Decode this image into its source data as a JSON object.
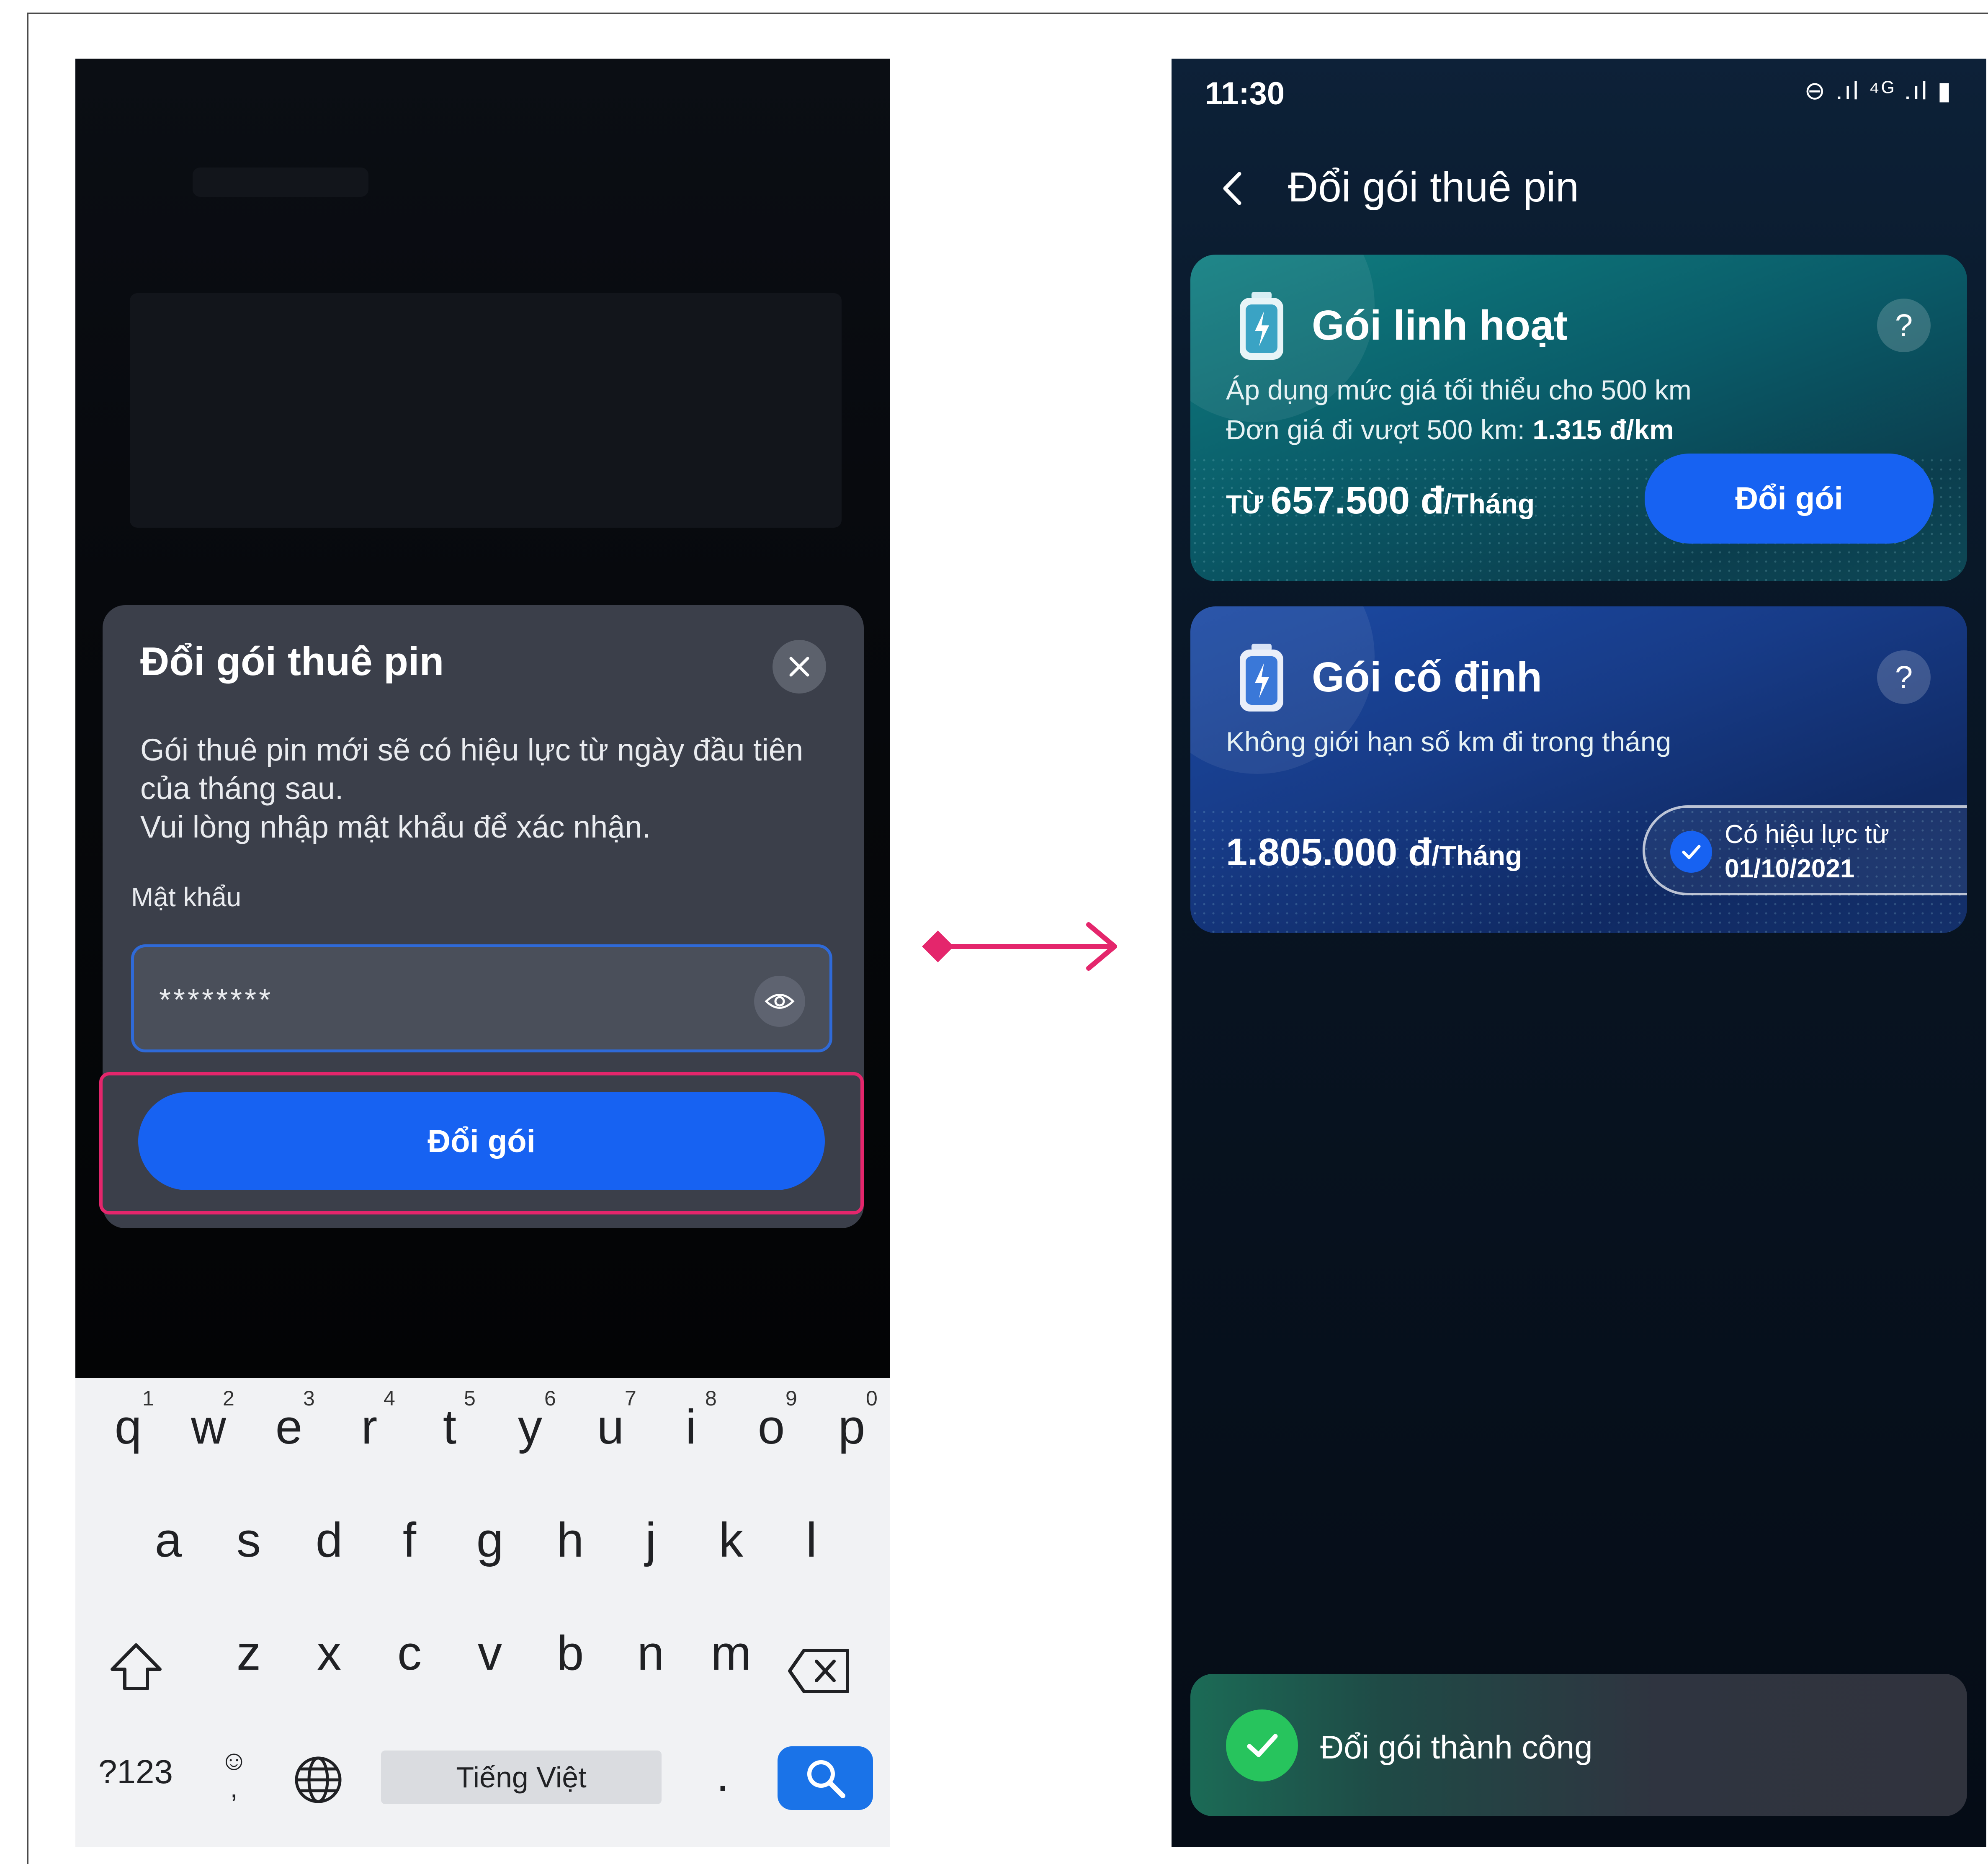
{
  "left_screen": {
    "dialog": {
      "title": "Đổi gói thuê pin",
      "body_line1": "Gói thuê pin mới sẽ có hiệu lực từ ngày đầu tiên của tháng sau.",
      "body_line2": "Vui lòng nhập mật khẩu để xác nhận.",
      "password_label": "Mật khẩu",
      "password_value": "********",
      "submit_label": "Đổi gói",
      "close_icon": "close-icon",
      "eye_icon": "eye-icon"
    },
    "keyboard": {
      "row1": [
        {
          "char": "q",
          "num": "1"
        },
        {
          "char": "w",
          "num": "2"
        },
        {
          "char": "e",
          "num": "3"
        },
        {
          "char": "r",
          "num": "4"
        },
        {
          "char": "t",
          "num": "5"
        },
        {
          "char": "y",
          "num": "6"
        },
        {
          "char": "u",
          "num": "7"
        },
        {
          "char": "i",
          "num": "8"
        },
        {
          "char": "o",
          "num": "9"
        },
        {
          "char": "p",
          "num": "0"
        }
      ],
      "row2": [
        "a",
        "s",
        "d",
        "f",
        "g",
        "h",
        "j",
        "k",
        "l"
      ],
      "row3": [
        "z",
        "x",
        "c",
        "v",
        "b",
        "n",
        "m"
      ],
      "symbols_label": "?123",
      "emoji_label": "☺",
      "comma_label": ",",
      "space_label": "Tiếng Việt",
      "dot_label": ".",
      "shift_icon": "shift-icon",
      "backspace_icon": "backspace-icon",
      "globe_icon": "globe-icon",
      "search_icon": "search-icon"
    }
  },
  "right_screen": {
    "status": {
      "time": "11:30",
      "icons": "⊖ .ıl ⁴ᴳ .ıl ▮"
    },
    "title": "Đổi gói thuê pin",
    "back_icon": "back-arrow-icon",
    "flexible_plan": {
      "title": "Gói linh hoạt",
      "desc1": "Áp dụng mức giá tối thiểu cho 500 km",
      "desc2_prefix": "Đơn giá đi vượt 500 km: ",
      "desc2_value": "1.315 đ/km",
      "price_prefix": "TỪ ",
      "price_value": "657.500",
      "price_currency": " đ",
      "price_period": "/Tháng",
      "button_label": "Đổi gói",
      "help": "?",
      "icon": "battery-icon"
    },
    "fixed_plan": {
      "title": "Gói cố định",
      "desc1": "Không giới hạn số km đi trong tháng",
      "price_value": "1.805.000",
      "price_currency": " đ",
      "price_period": "/Tháng",
      "effective_label": "Có hiệu lực từ",
      "effective_date": "01/10/2021",
      "help": "?",
      "icon": "battery-icon"
    },
    "toast": {
      "text": "Đổi gói thành công",
      "icon": "check-circle-icon"
    }
  },
  "colors": {
    "accent_blue": "#1762f2",
    "highlight_pink": "#e4266c",
    "success_green": "#27c45d"
  }
}
